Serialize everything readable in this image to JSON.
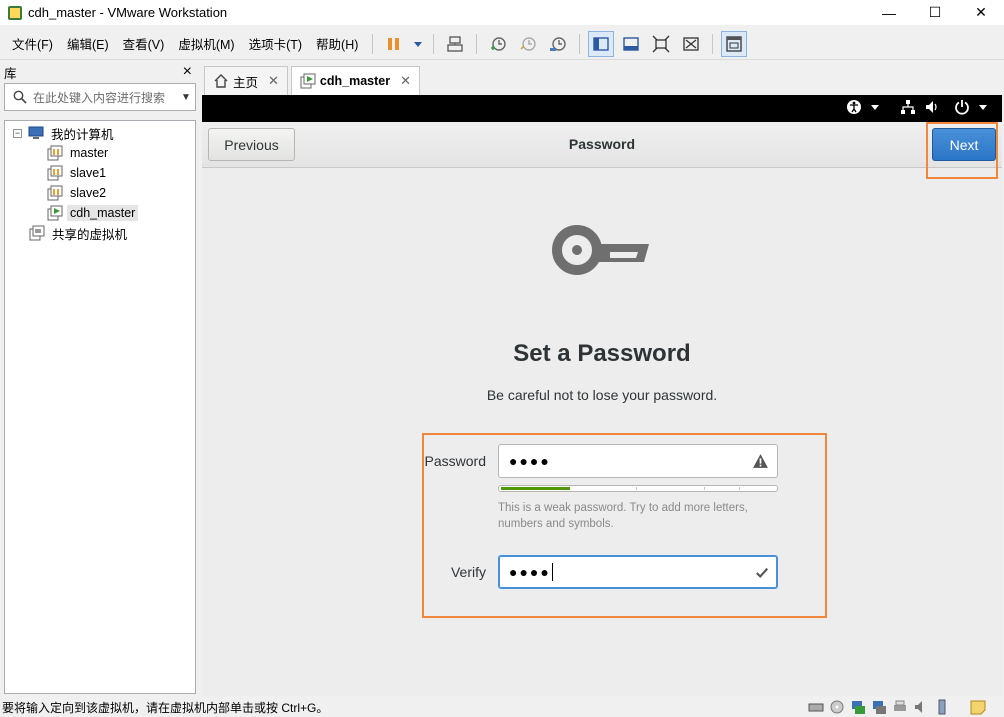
{
  "window": {
    "title": "cdh_master - VMware Workstation",
    "minimize": "—",
    "maximize": "☐",
    "close": "✕"
  },
  "menu": {
    "items": [
      "文件(F)",
      "编辑(E)",
      "查看(V)",
      "虚拟机(M)",
      "选项卡(T)",
      "帮助(H)"
    ]
  },
  "library": {
    "title": "库",
    "close": "×",
    "search_placeholder": "在此处键入内容进行搜索",
    "tree": {
      "root": "我的计算机",
      "vms": [
        "master",
        "slave1",
        "slave2",
        "cdh_master"
      ],
      "selected": "cdh_master",
      "shared": "共享的虚拟机"
    }
  },
  "tabs": [
    {
      "label": "主页",
      "close": "✕"
    },
    {
      "label": "cdh_master",
      "close": "✕"
    }
  ],
  "installer": {
    "previous": "Previous",
    "title": "Password",
    "next": "Next",
    "heading": "Set a Password",
    "subheading": "Be careful not to lose your password.",
    "password_label": "Password",
    "password_value": "●●●●",
    "strength_fraction": 0.25,
    "hint": "This is a weak password. Try to add more letters, numbers and symbols.",
    "verify_label": "Verify",
    "verify_value": "●●●●"
  },
  "status": {
    "text": "要将输入定向到该虚拟机，请在虚拟机内部单击或按 Ctrl+G。"
  },
  "colors": {
    "highlight": "#f0883c",
    "accent": "#4a90d9",
    "strength": "#4e9a06"
  }
}
